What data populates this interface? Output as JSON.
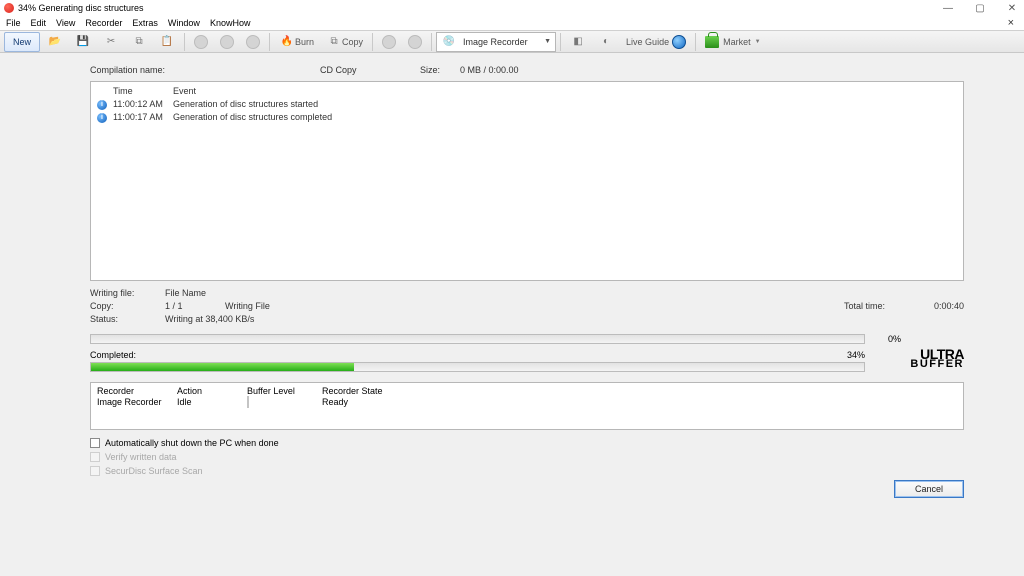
{
  "window": {
    "title": "34% Generating disc structures"
  },
  "menu": {
    "items": [
      "File",
      "Edit",
      "View",
      "Recorder",
      "Extras",
      "Window",
      "KnowHow"
    ]
  },
  "toolbar": {
    "new_label": "New",
    "burn_label": "Burn",
    "copy_label": "Copy",
    "recorder_selected": "Image Recorder",
    "liveguide_label": "Live Guide",
    "market_label": "Market"
  },
  "summary": {
    "compilation_label": "Compilation name:",
    "compilation_value": "CD Copy",
    "size_label": "Size:",
    "size_value": "0 MB  /   0:00.00"
  },
  "log": {
    "head_time": "Time",
    "head_event": "Event",
    "rows": [
      {
        "time": "11:00:12 AM",
        "event": "Generation of disc structures started"
      },
      {
        "time": "11:00:17 AM",
        "event": "Generation of disc structures completed"
      }
    ]
  },
  "status": {
    "writing_label": "Writing file:",
    "writing_value": "File Name",
    "copy_label": "Copy:",
    "copy_value": "1 / 1",
    "copy_extra": "Writing File",
    "status_label": "Status:",
    "status_value": "Writing at 38,400 KB/s",
    "total_label": "Total time:",
    "total_value": "0:00:40"
  },
  "progress": {
    "buffer_pct_text": "0%",
    "buffer_pct": 0,
    "completed_label": "Completed:",
    "completed_pct_text": "34%",
    "completed_pct": 34,
    "ultra_l1": "ULTra",
    "ultra_l2": "BUFFER"
  },
  "rec_table": {
    "h_rec": "Recorder",
    "h_act": "Action",
    "h_buf": "Buffer Level",
    "h_state": "Recorder State",
    "recorder": "Image Recorder",
    "action": "Idle",
    "state": "Ready"
  },
  "checks": {
    "shutdown": "Automatically shut down the PC when done",
    "verify": "Verify written data",
    "securdisc": "SecurDisc Surface Scan"
  },
  "buttons": {
    "cancel": "Cancel"
  }
}
